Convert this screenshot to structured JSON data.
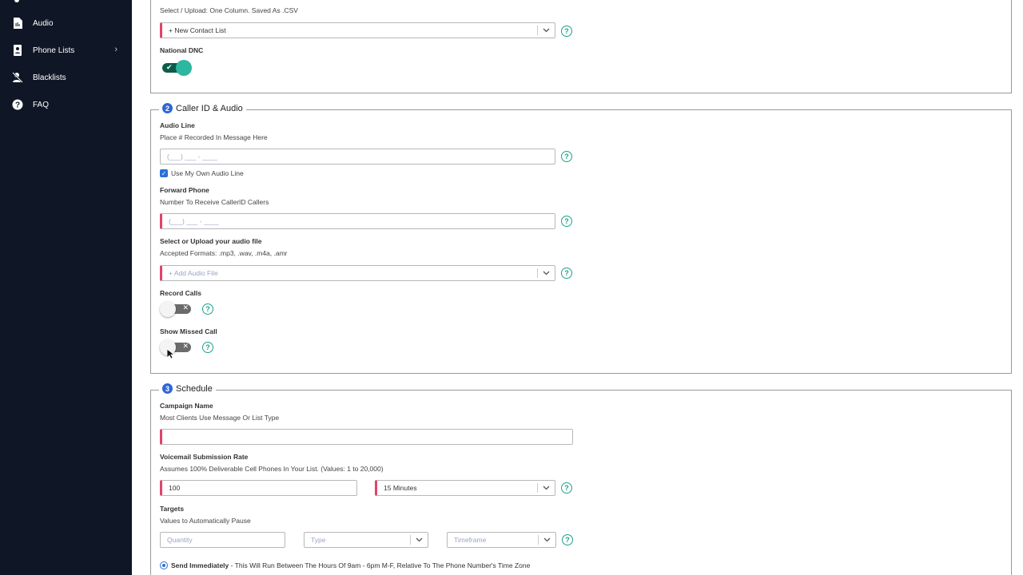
{
  "sidebar": {
    "items": [
      {
        "label": "Audio",
        "icon": "audio-file-icon"
      },
      {
        "label": "Phone Lists",
        "icon": "phone-list-icon"
      },
      {
        "label": "Blacklists",
        "icon": "blacklist-icon"
      },
      {
        "label": "FAQ",
        "icon": "help-circle-icon"
      }
    ]
  },
  "section1": {
    "upload_subtitle": "Select / Upload: One Column. Saved As .CSV",
    "contact_list_value": "+ New Contact List",
    "national_dnc_label": "National DNC",
    "national_dnc_on": true
  },
  "section2": {
    "step": "2",
    "title": "Caller ID & Audio",
    "audio_line_label": "Audio Line",
    "audio_line_sub": "Place # Recorded In Message Here",
    "audio_line_placeholder": "(___) ___ - ____",
    "use_own_line_label": "Use My Own Audio Line",
    "use_own_line_checked": true,
    "forward_phone_label": "Forward Phone",
    "forward_phone_sub": "Number To Receive CallerID Callers",
    "forward_phone_placeholder": "(___) ___ - ____",
    "audio_file_label": "Select or Upload your audio file",
    "audio_file_sub": "Accepted Formats: .mp3, .wav, .m4a, .amr",
    "audio_file_placeholder": "+ Add Audio File",
    "record_calls_label": "Record Calls",
    "record_calls_on": false,
    "show_missed_label": "Show Missed Call",
    "show_missed_on": false
  },
  "section3": {
    "step": "3",
    "title": "Schedule",
    "campaign_name_label": "Campaign Name",
    "campaign_name_sub": "Most Clients Use Message Or List Type",
    "campaign_name_value": "",
    "rate_label": "Voicemail Submission Rate",
    "rate_sub": "Assumes 100% Deliverable Cell Phones In Your List. (Values: 1 to 20,000)",
    "rate_value": "100",
    "rate_interval": "15 Minutes",
    "targets_label": "Targets",
    "targets_sub": "Values to Automatically Pause",
    "quantity_placeholder": "Quantity",
    "type_placeholder": "Type",
    "timeframe_placeholder": "Timeframe",
    "send_immediately_label": "Send Immediately",
    "send_immediately_desc": " - This Will Run Between The Hours Of 9am - 6pm M-F, Relative To The Phone Number's Time Zone"
  },
  "colors": {
    "sidebar_bg": "#0f1726",
    "required_marker": "#e0436b",
    "help_icon": "#1aa28b",
    "step_badge": "#2f66d6",
    "toggle_on": "#2db6a0"
  }
}
